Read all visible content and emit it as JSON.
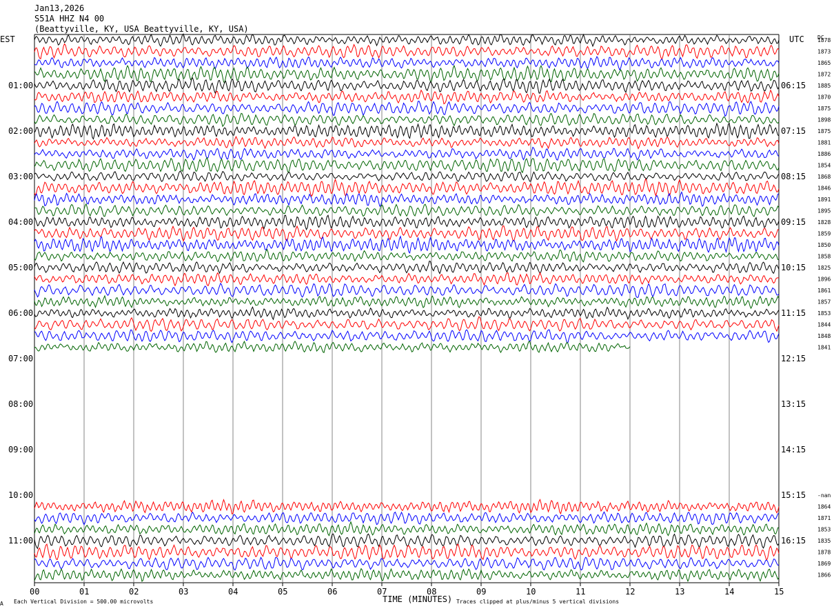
{
  "header": {
    "date": "Jan13,2026",
    "station": "S51A HHZ N4 00",
    "location": "(Beattyville, KY, USA Beattyville, KY, USA)"
  },
  "left_timezone": "EST",
  "right_timezone": "UTC",
  "dc_header": "DC",
  "footer": {
    "scale_text": "Each Vertical Division =  500.00 microvolts",
    "clip_text": "Traces clipped at plus/minus 5 vertical divisions",
    "corner_mark": "A"
  },
  "chart_data": {
    "type": "line",
    "title": "",
    "xlabel": "TIME (MINUTES)",
    "ylabel": "",
    "xlim": [
      0,
      15
    ],
    "x_ticks": [
      "00",
      "01",
      "02",
      "03",
      "04",
      "05",
      "06",
      "07",
      "08",
      "09",
      "10",
      "11",
      "12",
      "13",
      "14",
      "15"
    ],
    "left_hour_labels": [
      "01:00",
      "02:00",
      "03:00",
      "04:00",
      "05:00",
      "06:00",
      "07:00",
      "08:00",
      "09:00",
      "10:00",
      "11:00"
    ],
    "right_hour_labels": [
      "06:15",
      "07:15",
      "08:15",
      "09:15",
      "10:15",
      "11:15",
      "12:15",
      "13:15",
      "14:15",
      "15:15",
      "16:15"
    ],
    "trace_colors": [
      "#000000",
      "#ff0000",
      "#0000ff",
      "#006400"
    ],
    "traces_per_hour": 4,
    "total_rows": 48,
    "rows_present": [
      0,
      1,
      2,
      3,
      4,
      5,
      6,
      7,
      8,
      9,
      10,
      11,
      12,
      13,
      14,
      15,
      16,
      17,
      18,
      19,
      20,
      21,
      22,
      23,
      24,
      25,
      26,
      27,
      41,
      42,
      43,
      44,
      45,
      46,
      47
    ],
    "partial_end_minute": 12,
    "dc_offsets": [
      {
        "row": 0,
        "value": "1878"
      },
      {
        "row": 1,
        "value": "1873"
      },
      {
        "row": 2,
        "value": "1865"
      },
      {
        "row": 3,
        "value": "1872"
      },
      {
        "row": 4,
        "value": "1885"
      },
      {
        "row": 5,
        "value": "1870"
      },
      {
        "row": 6,
        "value": "1875"
      },
      {
        "row": 7,
        "value": "1898"
      },
      {
        "row": 8,
        "value": "1875"
      },
      {
        "row": 9,
        "value": "1881"
      },
      {
        "row": 10,
        "value": "1886"
      },
      {
        "row": 11,
        "value": "1854"
      },
      {
        "row": 12,
        "value": "1868"
      },
      {
        "row": 13,
        "value": "1846"
      },
      {
        "row": 14,
        "value": "1891"
      },
      {
        "row": 15,
        "value": "1895"
      },
      {
        "row": 16,
        "value": "1828"
      },
      {
        "row": 17,
        "value": "1859"
      },
      {
        "row": 18,
        "value": "1850"
      },
      {
        "row": 19,
        "value": "1858"
      },
      {
        "row": 20,
        "value": "1825"
      },
      {
        "row": 21,
        "value": "1896"
      },
      {
        "row": 22,
        "value": "1861"
      },
      {
        "row": 23,
        "value": "1857"
      },
      {
        "row": 24,
        "value": "1853"
      },
      {
        "row": 25,
        "value": "1844"
      },
      {
        "row": 26,
        "value": "1848"
      },
      {
        "row": 27,
        "value": "1841"
      },
      {
        "row": 40,
        "value": "-nan"
      },
      {
        "row": 41,
        "value": "1864"
      },
      {
        "row": 42,
        "value": "1871"
      },
      {
        "row": 43,
        "value": "1853"
      },
      {
        "row": 44,
        "value": "1835"
      },
      {
        "row": 45,
        "value": "1878"
      },
      {
        "row": 46,
        "value": "1869"
      },
      {
        "row": 47,
        "value": "1866"
      }
    ],
    "vertical_division_microvolts": 500.0,
    "clip_divisions": 5
  }
}
